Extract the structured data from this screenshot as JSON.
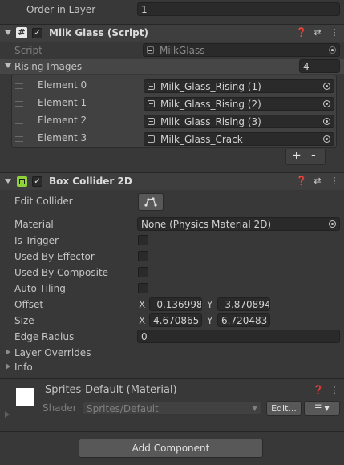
{
  "order_in_layer": {
    "label": "Order in Layer",
    "value": "1"
  },
  "milk_glass": {
    "title": "Milk Glass (Script)",
    "script_label": "Script",
    "script_value": "MilkGlass",
    "rising_label": "Rising Images",
    "rising_count": "4",
    "elements": [
      {
        "label": "Element 0",
        "value": "Milk_Glass_Rising (1)"
      },
      {
        "label": "Element 1",
        "value": "Milk_Glass_Rising (2)"
      },
      {
        "label": "Element 2",
        "value": "Milk_Glass_Rising (3)"
      },
      {
        "label": "Element 3",
        "value": "Milk_Glass_Crack"
      }
    ],
    "add_label": "+",
    "remove_label": "-"
  },
  "box_collider": {
    "title": "Box Collider 2D",
    "edit_collider_label": "Edit Collider",
    "material_label": "Material",
    "material_value": "None (Physics Material 2D)",
    "is_trigger_label": "Is Trigger",
    "used_by_effector_label": "Used By Effector",
    "used_by_composite_label": "Used By Composite",
    "auto_tiling_label": "Auto Tiling",
    "offset_label": "Offset",
    "offset_x": "-0.136998",
    "offset_y": "-3.870894",
    "size_label": "Size",
    "size_x": "4.670865",
    "size_y": "6.720483",
    "x_label": "X",
    "y_label": "Y",
    "edge_radius_label": "Edge Radius",
    "edge_radius_value": "0",
    "layer_overrides_label": "Layer Overrides",
    "info_label": "Info"
  },
  "material": {
    "name": "Sprites-Default (Material)",
    "shader_label": "Shader",
    "shader_value": "Sprites/Default",
    "edit_label": "Edit..."
  },
  "add_component_label": "Add Component"
}
